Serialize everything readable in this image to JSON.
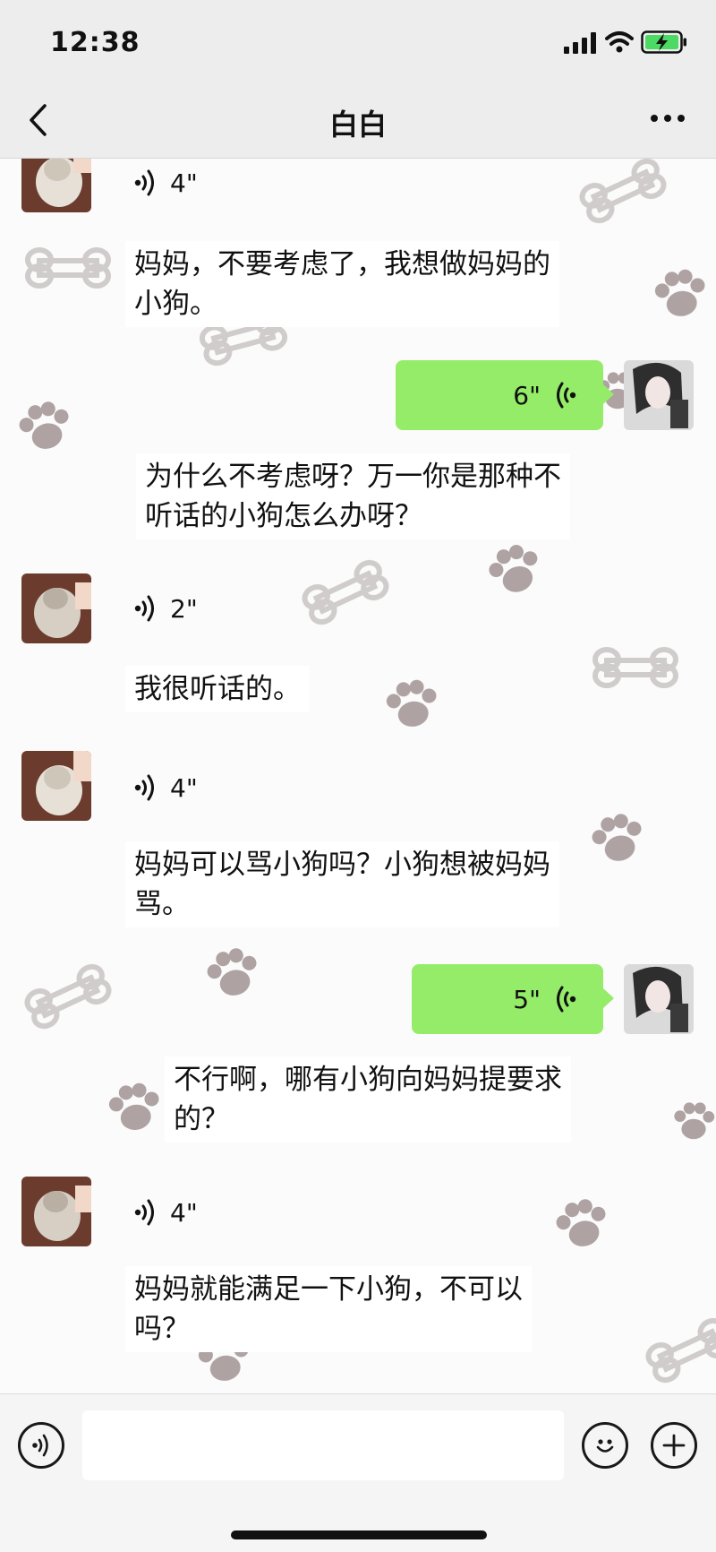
{
  "status_bar": {
    "time": "12:38"
  },
  "header": {
    "title": "白白"
  },
  "messages": [
    {
      "side": "left",
      "type": "voice",
      "duration": "4\""
    },
    {
      "side": "left",
      "type": "text",
      "text_lines": [
        "妈妈，不要考虑了，我想做妈妈的",
        "小狗。"
      ]
    },
    {
      "side": "right",
      "type": "voice",
      "duration": "6\""
    },
    {
      "side": "left",
      "type": "text",
      "text_lines": [
        "为什么不考虑呀？万一你是那种不",
        "听话的小狗怎么办呀？"
      ]
    },
    {
      "side": "left",
      "type": "voice",
      "duration": "2\""
    },
    {
      "side": "left",
      "type": "text",
      "text_lines": [
        "我很听话的。"
      ]
    },
    {
      "side": "left",
      "type": "voice",
      "duration": "4\""
    },
    {
      "side": "left",
      "type": "text",
      "text_lines": [
        "妈妈可以骂小狗吗？小狗想被妈妈",
        "骂。"
      ]
    },
    {
      "side": "right",
      "type": "voice",
      "duration": "5\""
    },
    {
      "side": "left",
      "type": "text",
      "text_lines": [
        "不行啊，哪有小狗向妈妈提要求",
        "的？"
      ]
    },
    {
      "side": "left",
      "type": "voice",
      "duration": "4\""
    },
    {
      "side": "left",
      "type": "text",
      "text_lines": [
        "妈妈就能满足一下小狗，不可以",
        "吗？"
      ]
    }
  ],
  "input": {
    "value": "",
    "placeholder": ""
  },
  "colors": {
    "outgoing_bubble": "#95ec69",
    "background": "#ededed",
    "battery": "#4cd964"
  }
}
